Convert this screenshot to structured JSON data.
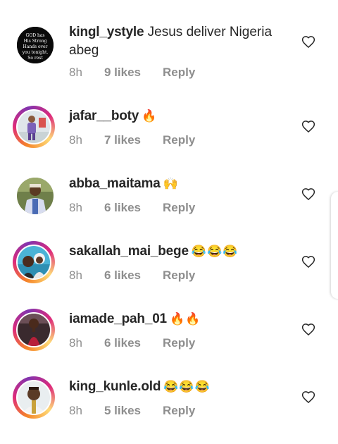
{
  "comments": [
    {
      "username": "kingl_ystyle",
      "text": "Jesus deliver Nigeria abeg",
      "emoji": "",
      "time": "8h",
      "likes": "9 likes",
      "reply": "Reply",
      "avatar_text": [
        "GOD has",
        "His Strong",
        "Hands over",
        "you tonight.",
        "So rest"
      ]
    },
    {
      "username": "jafar__boty",
      "text": "",
      "emoji": "🔥",
      "time": "8h",
      "likes": "7 likes",
      "reply": "Reply"
    },
    {
      "username": "abba_maitama",
      "text": "",
      "emoji": "🙌",
      "time": "8h",
      "likes": "6 likes",
      "reply": "Reply"
    },
    {
      "username": "sakallah_mai_bege",
      "text": "",
      "emoji": "😂😂😂",
      "time": "8h",
      "likes": "6 likes",
      "reply": "Reply"
    },
    {
      "username": "iamade_pah_01",
      "text": "",
      "emoji": "🔥🔥",
      "time": "8h",
      "likes": "6 likes",
      "reply": "Reply"
    },
    {
      "username": "king_kunle.old",
      "text": "",
      "emoji": "😂😂😂",
      "time": "8h",
      "likes": "5 likes",
      "reply": "Reply"
    }
  ]
}
